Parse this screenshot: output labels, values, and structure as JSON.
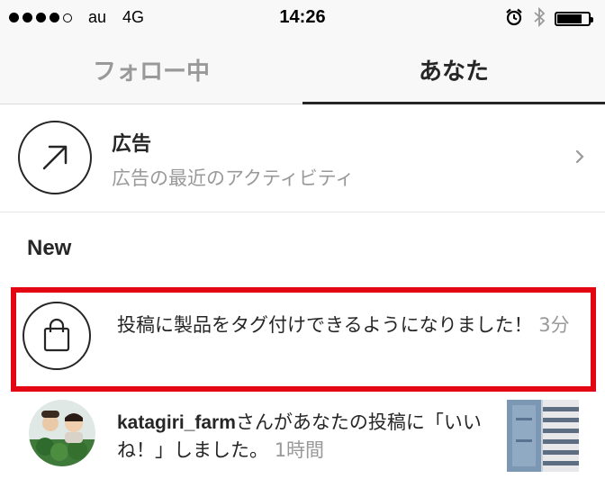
{
  "status_bar": {
    "carrier": "au",
    "network": "4G",
    "time": "14:26",
    "alarm_icon": "alarm-icon",
    "bluetooth_icon": "bluetooth-icon",
    "battery_icon": "battery-icon",
    "battery_level": 0.8,
    "signal_strength": 4,
    "signal_max": 5
  },
  "tabs": [
    {
      "label": "フォロー中",
      "active": false
    },
    {
      "label": "あなた",
      "active": true
    }
  ],
  "ads": {
    "title": "広告",
    "subtitle": "広告の最近のアクティビティ",
    "icon": "arrow-up-right-icon",
    "chevron": "chevron-right-icon"
  },
  "section_title": "New",
  "notifications": [
    {
      "icon": "shopping-bag-icon",
      "text": "投稿に製品をタグ付けできるようになりました！",
      "time": "3分",
      "highlighted": true
    },
    {
      "username": "katagiri_farm",
      "text": "さんがあなたの投稿に「いいね！」しました。",
      "time": "1時間"
    }
  ],
  "colors": {
    "highlight_border": "#e30613",
    "text_primary": "#262626",
    "text_secondary": "#999999",
    "background": "#ffffff",
    "bar_background": "#f8f8f8"
  }
}
